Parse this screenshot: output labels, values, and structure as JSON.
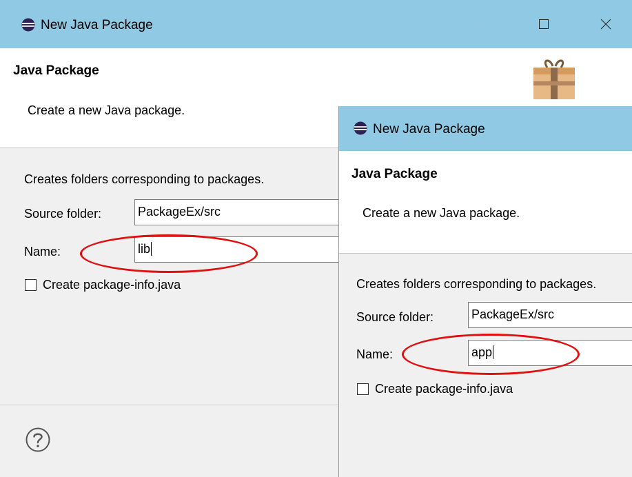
{
  "window1": {
    "title": "New Java Package",
    "header_title": "Java Package",
    "header_description": "Create a new Java package.",
    "intro_text": "Creates folders corresponding to packages.",
    "source_folder_label": "Source folder:",
    "source_folder_value": "PackageEx/src",
    "name_label": "Name:",
    "name_value": "lib",
    "checkbox_label": "Create package-info.java",
    "checkbox_checked": false
  },
  "window2": {
    "title": "New Java Package",
    "header_title": "Java Package",
    "header_description": "Create a new Java package.",
    "intro_text": "Creates folders corresponding to packages.",
    "source_folder_label": "Source folder:",
    "source_folder_value": "PackageEx/src",
    "name_label": "Name:",
    "name_value": "app",
    "checkbox_label": "Create package-info.java",
    "checkbox_checked": false
  },
  "icons": {
    "app_icon": "eclipse-icon",
    "help_icon": "help-icon",
    "wizard_banner_icon": "package-gift-icon"
  },
  "colors": {
    "titlebar": "#8fc9e4",
    "highlight": "#e01010"
  }
}
